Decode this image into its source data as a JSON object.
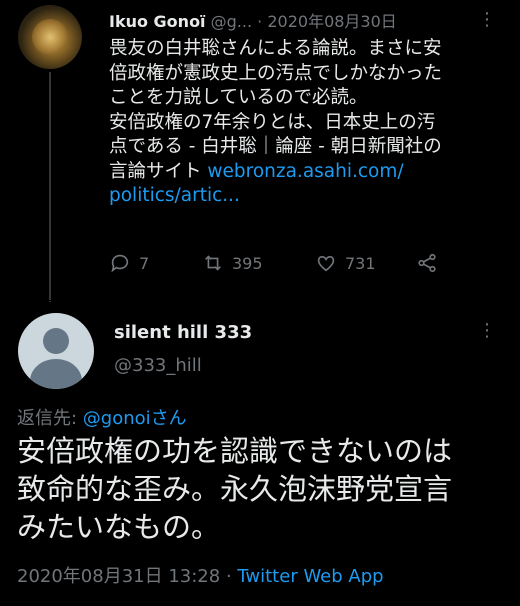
{
  "tweet1": {
    "name": "Ikuo Gonoï",
    "handle": "@g...",
    "separator": "·",
    "date": "2020年08月30日",
    "lines": [
      "畏友の白井聡さんによる論説。まさに安",
      "倍政権が憲政史上の汚点でしかなかった",
      "ことを力説しているので必読。",
      "安倍政権の7年余りとは、日本史上の汚",
      "点である - 白井聡｜論座 - 朝日新聞社の"
    ],
    "line6_text": "言論サイト ",
    "link_1": "webronza.asahi.com/",
    "link_2": "politics/artic...",
    "replies": "7",
    "retweets": "395",
    "likes": "731"
  },
  "tweet2": {
    "name": "silent hill 333",
    "handle": "@333_hill",
    "reply_prefix": "返信先: ",
    "reply_to": "@gonoiさん",
    "body_lines": [
      "安倍政権の功を認識できないのは",
      "致命的な歪み。永久泡沫野党宣言",
      "みたいなもの。"
    ],
    "timestamp": "2020年08月31日 13:28",
    "meta_sep": " · ",
    "app": "Twitter Web App"
  },
  "colors": {
    "accent": "#1d9bf0",
    "text": "#e7e9ea",
    "muted": "#71767b",
    "background": "#000000"
  },
  "icons": [
    "reply-icon",
    "retweet-icon",
    "like-icon",
    "share-icon",
    "more-icon"
  ]
}
